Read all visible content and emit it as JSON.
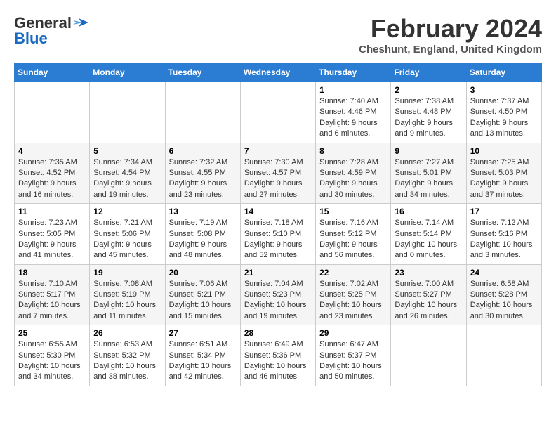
{
  "header": {
    "logo_general": "General",
    "logo_blue": "Blue",
    "month_year": "February 2024",
    "location": "Cheshunt, England, United Kingdom"
  },
  "days_of_week": [
    "Sunday",
    "Monday",
    "Tuesday",
    "Wednesday",
    "Thursday",
    "Friday",
    "Saturday"
  ],
  "weeks": [
    [
      {
        "day": "",
        "info": ""
      },
      {
        "day": "",
        "info": ""
      },
      {
        "day": "",
        "info": ""
      },
      {
        "day": "",
        "info": ""
      },
      {
        "day": "1",
        "info": "Sunrise: 7:40 AM\nSunset: 4:46 PM\nDaylight: 9 hours\nand 6 minutes."
      },
      {
        "day": "2",
        "info": "Sunrise: 7:38 AM\nSunset: 4:48 PM\nDaylight: 9 hours\nand 9 minutes."
      },
      {
        "day": "3",
        "info": "Sunrise: 7:37 AM\nSunset: 4:50 PM\nDaylight: 9 hours\nand 13 minutes."
      }
    ],
    [
      {
        "day": "4",
        "info": "Sunrise: 7:35 AM\nSunset: 4:52 PM\nDaylight: 9 hours\nand 16 minutes."
      },
      {
        "day": "5",
        "info": "Sunrise: 7:34 AM\nSunset: 4:54 PM\nDaylight: 9 hours\nand 19 minutes."
      },
      {
        "day": "6",
        "info": "Sunrise: 7:32 AM\nSunset: 4:55 PM\nDaylight: 9 hours\nand 23 minutes."
      },
      {
        "day": "7",
        "info": "Sunrise: 7:30 AM\nSunset: 4:57 PM\nDaylight: 9 hours\nand 27 minutes."
      },
      {
        "day": "8",
        "info": "Sunrise: 7:28 AM\nSunset: 4:59 PM\nDaylight: 9 hours\nand 30 minutes."
      },
      {
        "day": "9",
        "info": "Sunrise: 7:27 AM\nSunset: 5:01 PM\nDaylight: 9 hours\nand 34 minutes."
      },
      {
        "day": "10",
        "info": "Sunrise: 7:25 AM\nSunset: 5:03 PM\nDaylight: 9 hours\nand 37 minutes."
      }
    ],
    [
      {
        "day": "11",
        "info": "Sunrise: 7:23 AM\nSunset: 5:05 PM\nDaylight: 9 hours\nand 41 minutes."
      },
      {
        "day": "12",
        "info": "Sunrise: 7:21 AM\nSunset: 5:06 PM\nDaylight: 9 hours\nand 45 minutes."
      },
      {
        "day": "13",
        "info": "Sunrise: 7:19 AM\nSunset: 5:08 PM\nDaylight: 9 hours\nand 48 minutes."
      },
      {
        "day": "14",
        "info": "Sunrise: 7:18 AM\nSunset: 5:10 PM\nDaylight: 9 hours\nand 52 minutes."
      },
      {
        "day": "15",
        "info": "Sunrise: 7:16 AM\nSunset: 5:12 PM\nDaylight: 9 hours\nand 56 minutes."
      },
      {
        "day": "16",
        "info": "Sunrise: 7:14 AM\nSunset: 5:14 PM\nDaylight: 10 hours\nand 0 minutes."
      },
      {
        "day": "17",
        "info": "Sunrise: 7:12 AM\nSunset: 5:16 PM\nDaylight: 10 hours\nand 3 minutes."
      }
    ],
    [
      {
        "day": "18",
        "info": "Sunrise: 7:10 AM\nSunset: 5:17 PM\nDaylight: 10 hours\nand 7 minutes."
      },
      {
        "day": "19",
        "info": "Sunrise: 7:08 AM\nSunset: 5:19 PM\nDaylight: 10 hours\nand 11 minutes."
      },
      {
        "day": "20",
        "info": "Sunrise: 7:06 AM\nSunset: 5:21 PM\nDaylight: 10 hours\nand 15 minutes."
      },
      {
        "day": "21",
        "info": "Sunrise: 7:04 AM\nSunset: 5:23 PM\nDaylight: 10 hours\nand 19 minutes."
      },
      {
        "day": "22",
        "info": "Sunrise: 7:02 AM\nSunset: 5:25 PM\nDaylight: 10 hours\nand 23 minutes."
      },
      {
        "day": "23",
        "info": "Sunrise: 7:00 AM\nSunset: 5:27 PM\nDaylight: 10 hours\nand 26 minutes."
      },
      {
        "day": "24",
        "info": "Sunrise: 6:58 AM\nSunset: 5:28 PM\nDaylight: 10 hours\nand 30 minutes."
      }
    ],
    [
      {
        "day": "25",
        "info": "Sunrise: 6:55 AM\nSunset: 5:30 PM\nDaylight: 10 hours\nand 34 minutes."
      },
      {
        "day": "26",
        "info": "Sunrise: 6:53 AM\nSunset: 5:32 PM\nDaylight: 10 hours\nand 38 minutes."
      },
      {
        "day": "27",
        "info": "Sunrise: 6:51 AM\nSunset: 5:34 PM\nDaylight: 10 hours\nand 42 minutes."
      },
      {
        "day": "28",
        "info": "Sunrise: 6:49 AM\nSunset: 5:36 PM\nDaylight: 10 hours\nand 46 minutes."
      },
      {
        "day": "29",
        "info": "Sunrise: 6:47 AM\nSunset: 5:37 PM\nDaylight: 10 hours\nand 50 minutes."
      },
      {
        "day": "",
        "info": ""
      },
      {
        "day": "",
        "info": ""
      }
    ]
  ]
}
